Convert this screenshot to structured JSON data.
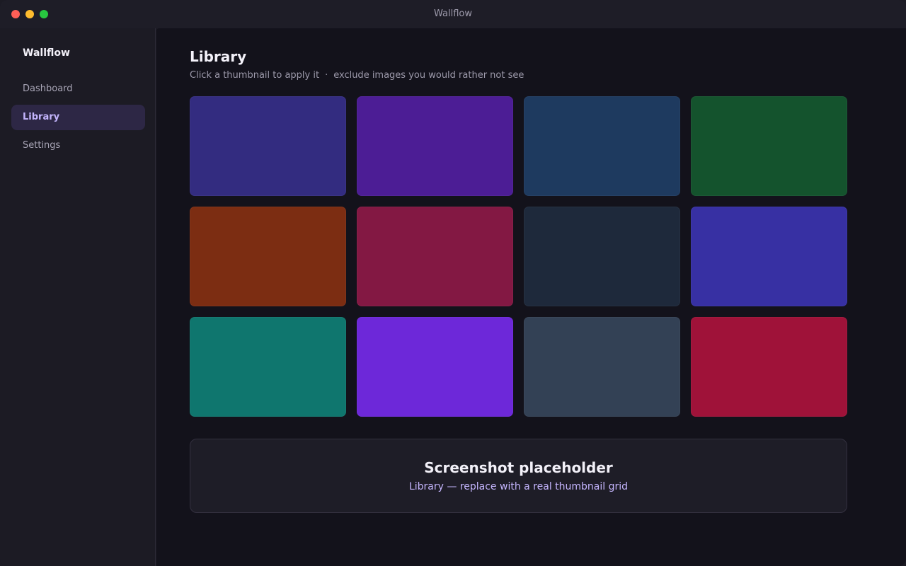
{
  "window": {
    "title": "Wallflow"
  },
  "sidebar": {
    "brand": "Wallflow",
    "items": [
      {
        "label": "Dashboard",
        "active": false
      },
      {
        "label": "Library",
        "active": true
      },
      {
        "label": "Settings",
        "active": false
      }
    ]
  },
  "main": {
    "title": "Library",
    "subtitle_left": "Click a thumbnail to apply it",
    "subtitle_sep": "·",
    "subtitle_right": "exclude images you would rather not see",
    "thumbnails": [
      {
        "color": "#332c80"
      },
      {
        "color": "#4c1d95"
      },
      {
        "color": "#1e3a5f"
      },
      {
        "color": "#14532d"
      },
      {
        "color": "#7c2d12"
      },
      {
        "color": "#831843"
      },
      {
        "color": "#1e293b"
      },
      {
        "color": "#3730a3"
      },
      {
        "color": "#0f766e"
      },
      {
        "color": "#6d28d9"
      },
      {
        "color": "#334155"
      },
      {
        "color": "#9f1239"
      }
    ],
    "placeholder": {
      "title": "Screenshot placeholder",
      "subtitle": "Library — replace with a real thumbnail grid"
    }
  },
  "colors": {
    "accent": "#c4b5fd",
    "active_nav_bg": "#2d2745"
  }
}
